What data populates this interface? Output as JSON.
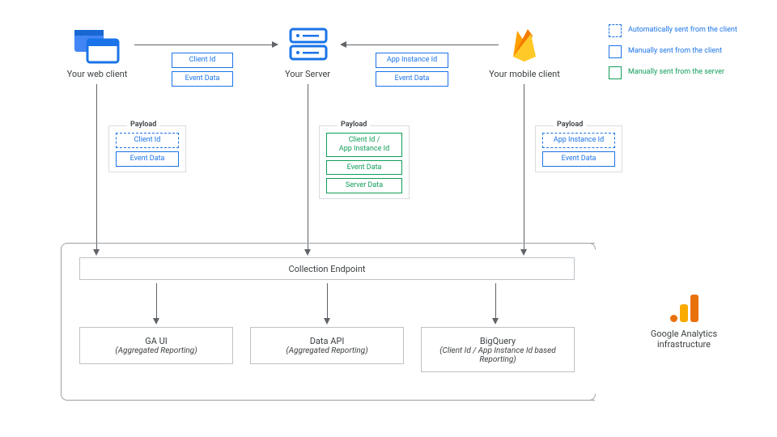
{
  "nodes": {
    "web_client": "Your web client",
    "server": "Your Server",
    "mobile_client": "Your mobile client"
  },
  "web_to_server": {
    "box1": "Client Id",
    "box2": "Event Data"
  },
  "mobile_to_server": {
    "box1": "App Instance Id",
    "box2": "Event Data"
  },
  "payload_label": "Payload",
  "payload_web": {
    "box1": "Client Id",
    "box2": "Event Data"
  },
  "payload_server": {
    "box1": "Client Id /\nApp Instance Id",
    "box2": "Event Data",
    "box3": "Server Data"
  },
  "payload_mobile": {
    "box1": "App Instance Id",
    "box2": "Event Data"
  },
  "collection": "Collection Endpoint",
  "outputs": {
    "ga_ui": {
      "title": "GA UI",
      "sub": "(Aggregated Reporting)"
    },
    "data_api": {
      "title": "Data API",
      "sub": "(Aggregated Reporting)"
    },
    "bigquery": {
      "title": "BigQuery",
      "sub": "(Client Id / App Instance Id based Reporting)"
    }
  },
  "infra_label": "Google Analytics infrastructure",
  "legend": {
    "auto_client": "Automatically sent from the client",
    "manual_client": "Manually sent from the client",
    "manual_server": "Manually sent from the server"
  },
  "icons": {
    "web": "browser-windows-icon",
    "server": "server-stack-icon",
    "firebase": "firebase-flame-icon",
    "ga": "google-analytics-icon"
  }
}
